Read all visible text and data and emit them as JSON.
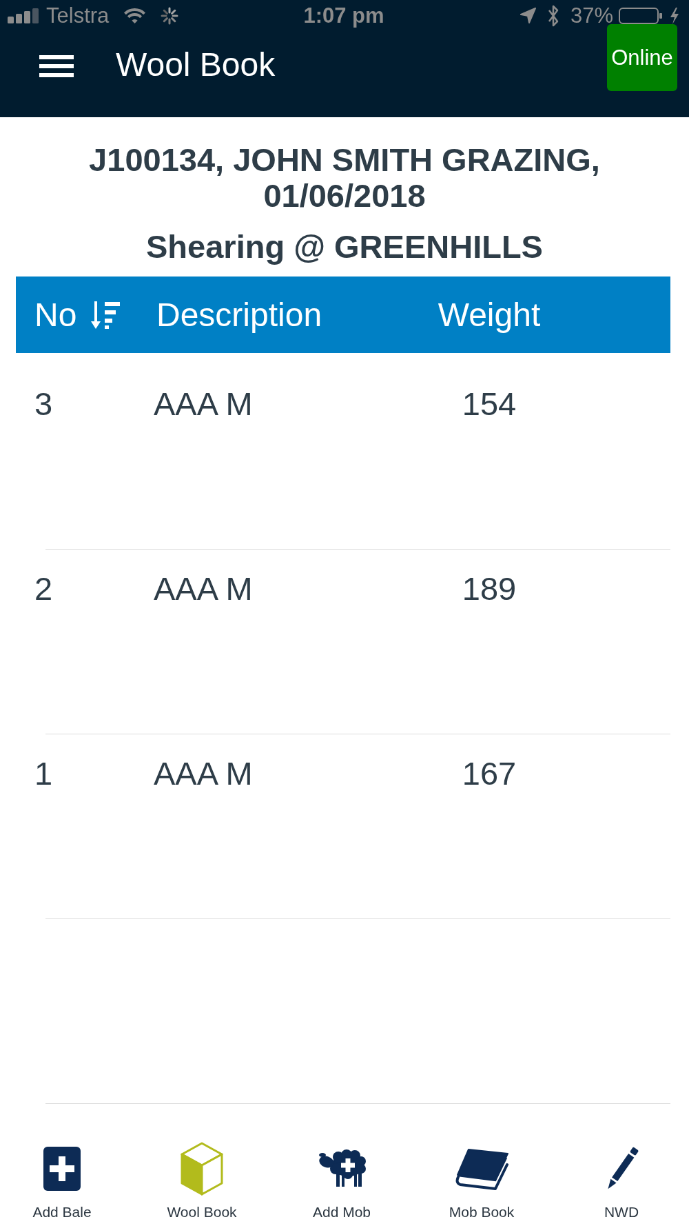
{
  "status_bar": {
    "carrier": "Telstra",
    "time": "1:07 pm",
    "battery": "37%",
    "charging": true
  },
  "top_bar": {
    "title": "Wool Book",
    "status_button": {
      "label": "Online",
      "online": true
    }
  },
  "job": {
    "title": "J100134, JOHN SMITH GRAZING, 01/06/2018",
    "subtitle": "Shearing @ GREENHILLS"
  },
  "table": {
    "columns": [
      {
        "label": "No",
        "sorted": true
      },
      {
        "label": "Description"
      },
      {
        "label": "Weight"
      }
    ],
    "rows": [
      {
        "no": "3",
        "description": "AAA M",
        "weight": "154"
      },
      {
        "no": "2",
        "description": "AAA M",
        "weight": "189"
      },
      {
        "no": "1",
        "description": "AAA M",
        "weight": "167"
      }
    ]
  },
  "bottom_nav": [
    {
      "label": "Add Bale",
      "kind": "add-bale",
      "selected": false
    },
    {
      "label": "Wool Book",
      "kind": "bale",
      "selected": true
    },
    {
      "label": "Add Mob",
      "kind": "add-mob",
      "selected": false
    },
    {
      "label": "Mob Book",
      "kind": "mob-book",
      "selected": false
    },
    {
      "label": "NWD",
      "kind": "pencil",
      "selected": false
    }
  ]
}
